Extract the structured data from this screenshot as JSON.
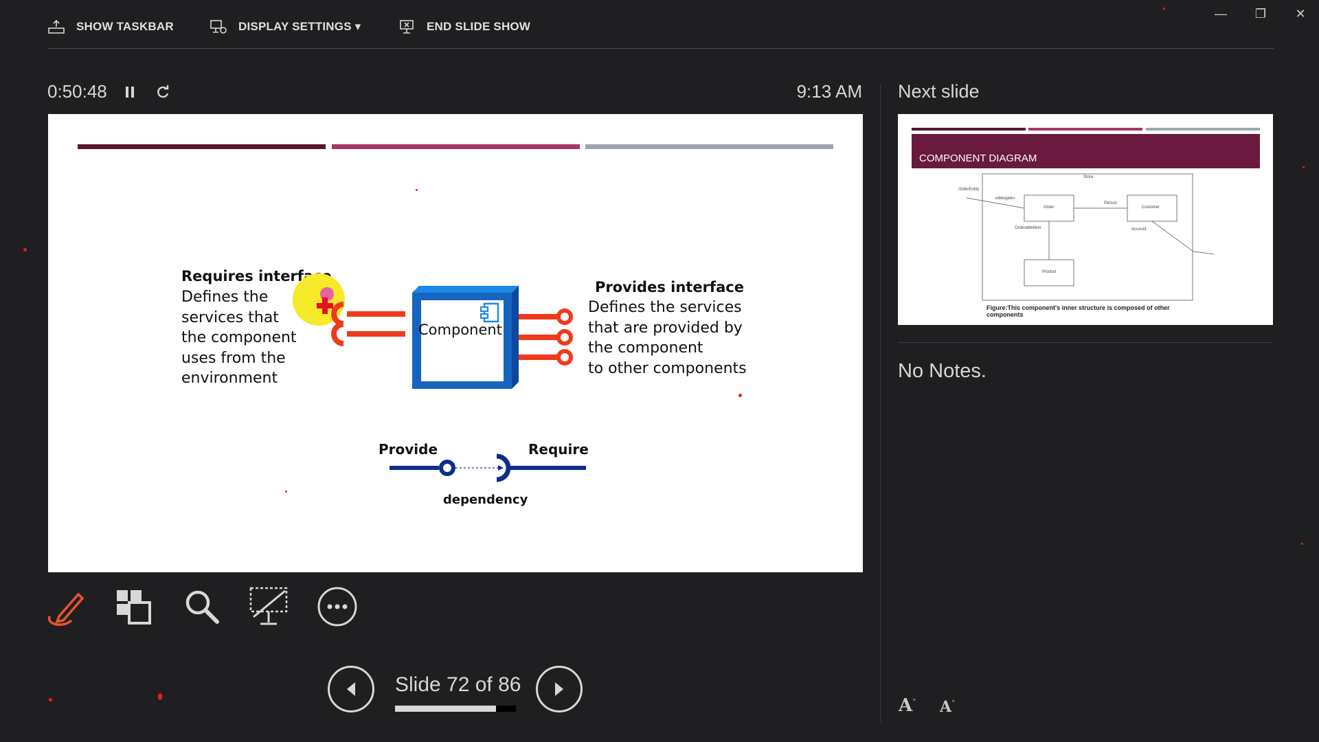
{
  "toolbar": {
    "show_taskbar": "SHOW TASKBAR",
    "display_settings": "DISPLAY SETTINGS ▾",
    "end_slide_show": "END SLIDE SHOW"
  },
  "timer": {
    "elapsed": "0:50:48",
    "pause_icon": "pause-icon",
    "restart_icon": "restart-icon"
  },
  "clock": "9:13 AM",
  "next_slide": {
    "label": "Next slide",
    "title": "COMPONENT DIAGRAM",
    "labels": [
      "Store",
      "OrderEntity",
      "«delegate»",
      "Order",
      "Person",
      "Customer",
      "Account",
      "OrderableItem",
      "Product"
    ],
    "caption": "Figure:This component's inner structure is composed of other components"
  },
  "current_slide": {
    "requires_title": "Requires interface",
    "requires_lines": [
      "Defines the",
      "services that",
      "the component",
      "uses from the",
      "environment"
    ],
    "component_label": "Component",
    "provides_title": "Provides interface",
    "provides_lines": [
      "Defines the services",
      "that are provided by",
      "the component",
      "to other components"
    ],
    "provide_label": "Provide",
    "require_label": "Require",
    "dependency_label": "dependency"
  },
  "notes": "No Notes.",
  "navigation": {
    "slide_text": "Slide 72 of 86",
    "current": 72,
    "total": 86,
    "progress_fraction": 0.837
  },
  "colors": {
    "background": "#1f1f21",
    "bar1": "#5b1530",
    "bar2": "#a8346a",
    "bar3": "#a0a4ab",
    "pen_tool": "#e8552c",
    "component_blue": "#1565c0",
    "interface_red": "#ef3a1a"
  }
}
